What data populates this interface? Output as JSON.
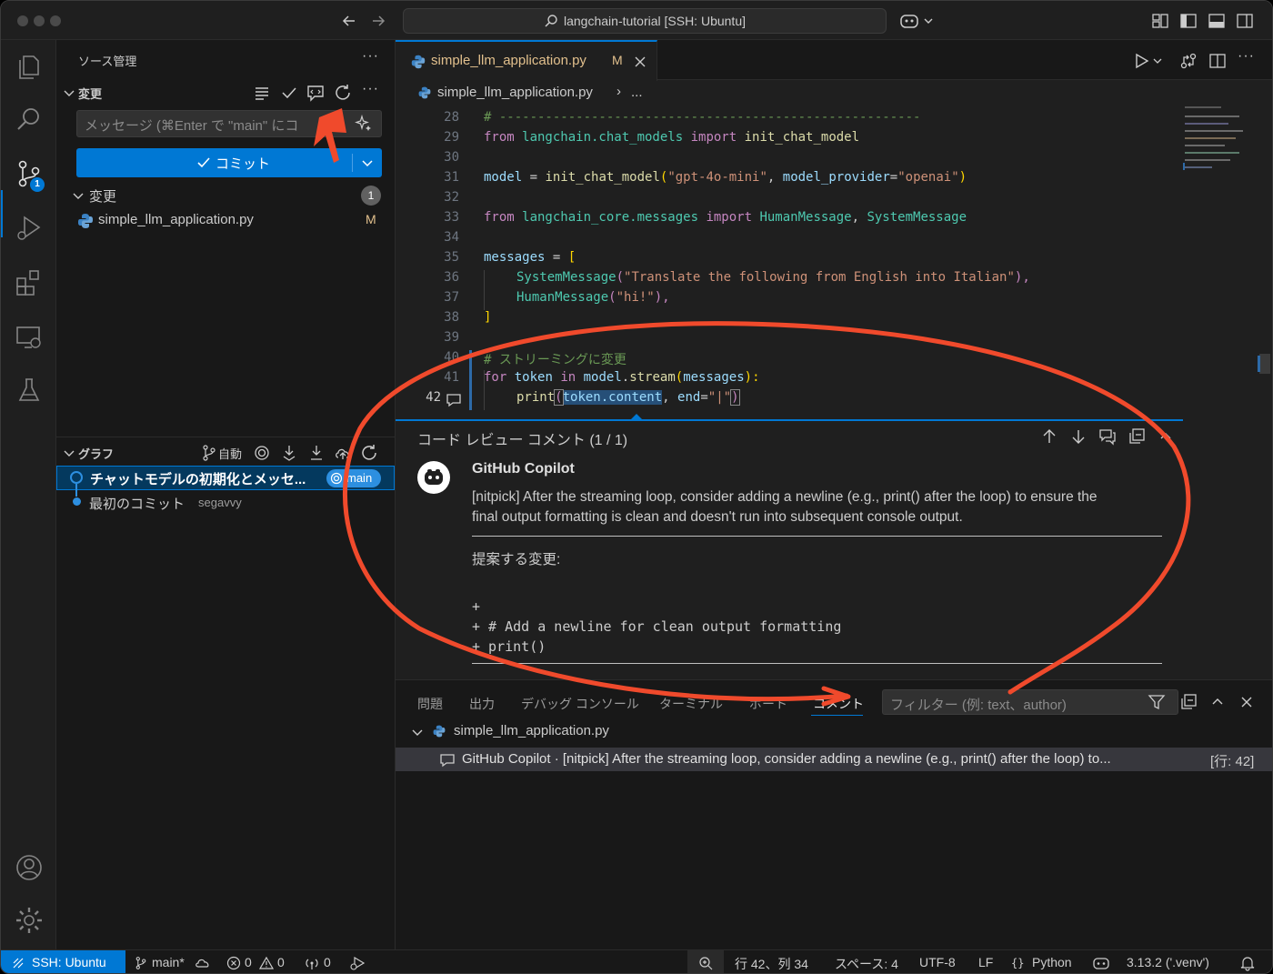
{
  "titlebar": {
    "search_text": "langchain-tutorial [SSH: Ubuntu]"
  },
  "activitybar": {
    "scm_badge": "1"
  },
  "sidebar": {
    "title": "ソース管理",
    "changes_section": "変更",
    "message_placeholder": "メッセージ (⌘Enter で \"main\" にコ",
    "commit_label": "コミット",
    "changes_group": "変更",
    "changes_count": "1",
    "changed_file": {
      "name": "simple_llm_application.py",
      "status": "M"
    },
    "graph_section": "グラフ",
    "graph_auto": "自動",
    "commits": [
      {
        "message": "チャットモデルの初期化とメッセ...",
        "ref": "main"
      },
      {
        "message": "最初のコミット",
        "author": "segavvy"
      }
    ]
  },
  "editor": {
    "tab": {
      "name": "simple_llm_application.py",
      "modified": "M"
    },
    "breadcrumb": {
      "file": "simple_llm_application.py",
      "rest": "..."
    },
    "active_line": "42",
    "lines": [
      "28",
      "29",
      "30",
      "31",
      "32",
      "33",
      "34",
      "35",
      "36",
      "37",
      "38",
      "39",
      "40",
      "41",
      "42"
    ],
    "code": {
      "l28": "# -------------------------------------------------------",
      "l29_kw1": "from",
      "l29_mod": " langchain.chat_models ",
      "l29_kw2": "import",
      "l29_fn": " init_chat_model",
      "l31_var": "model",
      "l31_eq": " = ",
      "l31_fn": "init_chat_model",
      "l31_p1": "(",
      "l31_s1": "\"gpt-4o-mini\"",
      "l31_c": ", ",
      "l31_k": "model_provider",
      "l31_eq2": "=",
      "l31_s2": "\"openai\"",
      "l31_p2": ")",
      "l33_kw1": "from",
      "l33_mod": " langchain_core.messages ",
      "l33_kw2": "import",
      "l33_c1": " HumanMessage",
      "l33_sep": ", ",
      "l33_c2": "SystemMessage",
      "l35_var": "messages",
      "l35_eq": " = ",
      "l35_br": "[",
      "l36_cls": "SystemMessage",
      "l36_p1": "(",
      "l36_s": "\"Translate the following from English into Italian\"",
      "l36_p2": "),",
      "l37_cls": "HumanMessage",
      "l37_p1": "(",
      "l37_s": "\"hi!\"",
      "l37_p2": "),",
      "l38_br": "]",
      "l40": "# ストリーミングに変更",
      "l41_kw1": "for",
      "l41_var": " token ",
      "l41_kw2": "in",
      "l41_obj": " model",
      "l41_dot": ".",
      "l41_fn": "stream",
      "l41_p1": "(",
      "l41_arg": "messages",
      "l41_p2": "):",
      "l42_fn": "print",
      "l42_p1": "(",
      "l42_a1": "token.content",
      "l42_c": ", ",
      "l42_k": "end",
      "l42_eq": "=",
      "l42_s": "\"|\"",
      "l42_p2": ")"
    }
  },
  "review": {
    "header": "コード レビュー コメント (1 / 1)",
    "author": "GitHub Copilot",
    "body_line1": "[nitpick] After the streaming loop, consider adding a newline (e.g., print() after the loop) to ensure the",
    "body_line2": "final output formatting is clean and doesn't run into subsequent console output.",
    "suggest_label": "提案する変更:",
    "diff": [
      "+",
      "+ # Add a newline for clean output formatting",
      "+ print()"
    ]
  },
  "panel": {
    "tabs": [
      "問題",
      "出力",
      "デバッグ コンソール",
      "ターミナル",
      "ポート",
      "コメント"
    ],
    "active_tab": "コメント",
    "filter_placeholder": "フィルター (例: text、author)",
    "file": "simple_llm_application.py",
    "comment": "GitHub Copilot · [nitpick] After the streaming loop, consider adding a newline (e.g., print() after the loop) to...",
    "comment_line": "[行: 42]"
  },
  "statusbar": {
    "remote": "SSH: Ubuntu",
    "branch": "main*",
    "errors": "0",
    "warnings": "0",
    "ports": "0",
    "position": "行 42、列 34",
    "spaces": "スペース: 4",
    "encoding": "UTF-8",
    "eol": "LF",
    "language": "Python",
    "interpreter": "3.13.2 ('.venv')"
  },
  "colors": {
    "accent": "#0078d4",
    "annotation": "#f04a2c"
  }
}
